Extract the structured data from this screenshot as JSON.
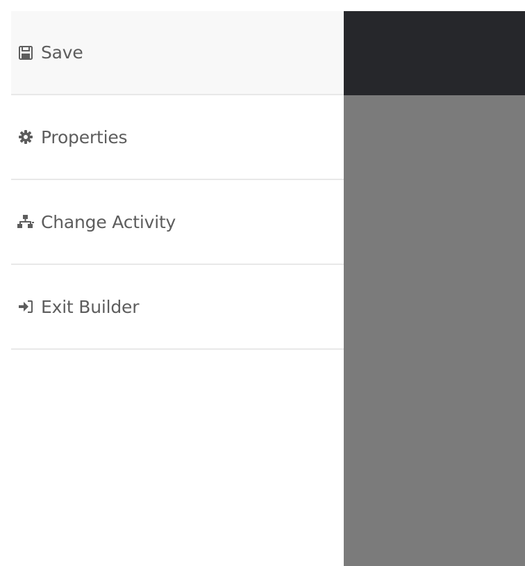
{
  "menu": {
    "items": [
      {
        "label": "Save",
        "icon": "save-icon"
      },
      {
        "label": "Properties",
        "icon": "gear-icon"
      },
      {
        "label": "Change Activity",
        "icon": "sitemap-icon"
      },
      {
        "label": "Exit Builder",
        "icon": "sign-in-icon"
      }
    ]
  },
  "colors": {
    "menu_text": "#5d5d5d",
    "divider": "#e8e8e8",
    "header_dark": "#26272b",
    "overlay_gray": "#7b7b7b"
  }
}
